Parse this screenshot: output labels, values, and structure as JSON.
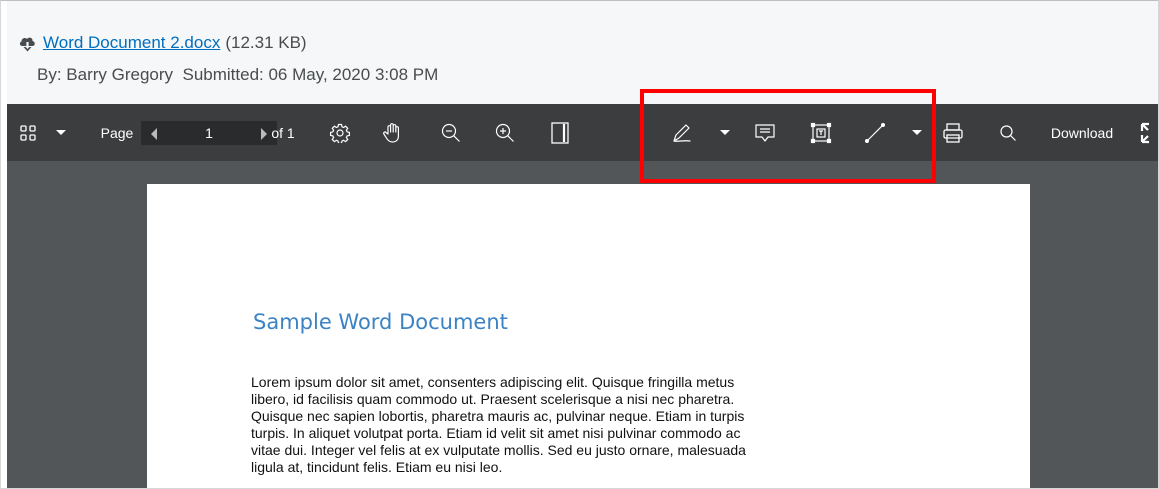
{
  "file": {
    "name": "Word Document 2.docx",
    "size": "(12.31 KB)",
    "submitted_line": "By: Barry Gregory  Submitted: 06 May, 2020 3:08 PM"
  },
  "toolbar": {
    "page_label": "Page",
    "page_value": "1",
    "page_of": "of 1",
    "download_label": "Download",
    "icons": [
      "grid-icon",
      "dropdown-icon",
      "prev-page-icon",
      "next-page-icon",
      "settings-icon",
      "hand-pan-icon",
      "zoom-out-icon",
      "zoom-in-icon",
      "fit-page-icon",
      "freehand-draw-icon",
      "comment-icon",
      "text-box-icon",
      "line-draw-icon",
      "print-icon",
      "search-icon",
      "fullscreen-icon"
    ]
  },
  "document": {
    "title": "Sample Word Document",
    "body_lines": [
      "Lorem ipsum dolor sit amet, consenters adipiscing elit. Quisque fringilla metus",
      "libero, id facilisis quam commodo ut. Praesent scelerisque a nisi nec pharetra.",
      "Quisque nec sapien lobortis, pharetra mauris ac, pulvinar neque. Etiam in turpis",
      "turpis. In aliquet volutpat porta. Etiam id velit sit amet nisi pulvinar commodo ac",
      "vitae dui. Integer vel felis at ex vulputate mollis. Sed eu justo ornare, malesuada",
      "ligula at, tincidunt felis. Etiam eu nisi leo."
    ]
  },
  "colors": {
    "toolbar_bg": "#3b3d3f",
    "viewer_bg": "#525659",
    "link": "#006fbf",
    "title": "#3b83c4",
    "highlight": "#ff0000"
  }
}
